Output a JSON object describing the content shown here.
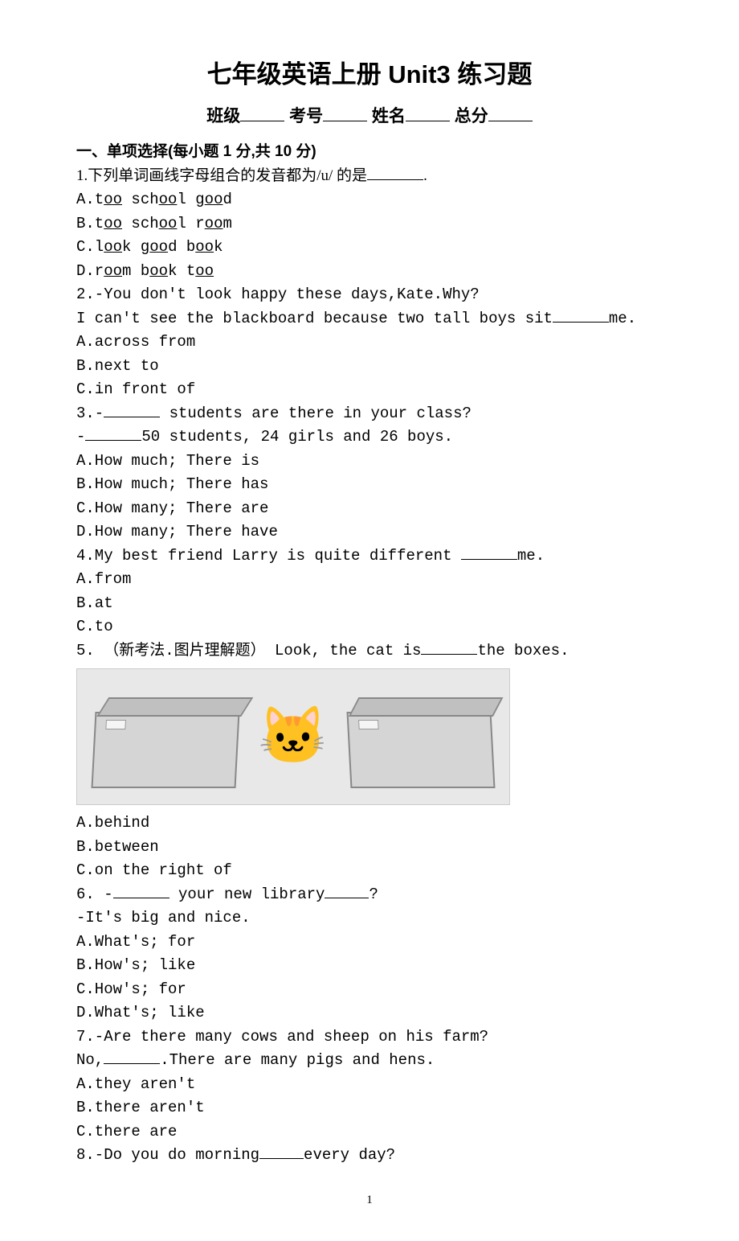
{
  "title": "七年级英语上册 Unit3 练习题",
  "header": {
    "class_label": "班级",
    "exam_no_label": "考号",
    "name_label": "姓名",
    "total_label": "总分"
  },
  "section1": {
    "heading": "一、单项选择(每小题 1 分,共 10 分)"
  },
  "q1": {
    "stem_pre": "1.下列单词画线字母组合的发音都为/u/ 的是",
    "stem_post": ".",
    "a_pre": "A.t",
    "a_u1": "oo",
    "a_mid1": "   sch",
    "a_u2": "oo",
    "a_mid2": "l   g",
    "a_u3": "oo",
    "a_post": "d",
    "b_pre": "B.t",
    "b_u1": "oo",
    "b_mid1": " sch",
    "b_u2": "oo",
    "b_mid2": "l r",
    "b_u3": "oo",
    "b_post": "m",
    "c_pre": "C.l",
    "c_u1": "oo",
    "c_mid1": "k   g",
    "c_u2": "oo",
    "c_mid2": "d   b",
    "c_u3": "oo",
    "c_post": "k",
    "d_pre": "D.r",
    "d_u1": "oo",
    "d_mid1": "m b",
    "d_u2": "oo",
    "d_mid2": "k t",
    "d_u3": "oo",
    "d_post": ""
  },
  "q2": {
    "line1": "2.-You don't look happy these days,Kate.Why?",
    "line2_pre": "I can't see the blackboard because two tall boys sit",
    "line2_post": "me.",
    "a": "A.across from",
    "b": "B.next to",
    "c": "C.in front of"
  },
  "q3": {
    "line1_pre": "3.-",
    "line1_post": " students are there in your class?",
    "line2_pre": "-",
    "line2_post": "50 students, 24 girls and 26 boys.",
    "a": "A.How much; There is",
    "b": "B.How much; There has",
    "c": "C.How many; There are",
    "d": "D.How many; There have"
  },
  "q4": {
    "line1_pre": "4.My best friend Larry is quite different ",
    "line1_post": "me.",
    "a": "A.from",
    "b": "B.at",
    "c": "C.to"
  },
  "q5": {
    "line1_pre": "5. （新考法.图片理解题） Look, the cat is",
    "line1_post": "the boxes.",
    "a": "A.behind",
    "b": "B.between",
    "c": "C.on the right of"
  },
  "q6": {
    "line1_pre": "6. -",
    "line1_mid": " your new library",
    "line1_post": "?",
    "line2": "-It's big and nice.",
    "a": "A.What's; for",
    "b": "B.How's; like",
    "c": "C.How's; for",
    "d": "D.What's; like"
  },
  "q7": {
    "line1": "7.-Are there many cows and sheep on his farm?",
    "line2_pre": "No,",
    "line2_post": ".There are many pigs and hens.",
    "a": "A.they aren't",
    "b": "B.there aren't",
    "c": "C.there are"
  },
  "q8": {
    "line1_pre": "8.-Do you do morning",
    "line1_post": "every day?"
  },
  "page_number": "1",
  "image_description": "A cartoon cat sitting between two gray boxes"
}
